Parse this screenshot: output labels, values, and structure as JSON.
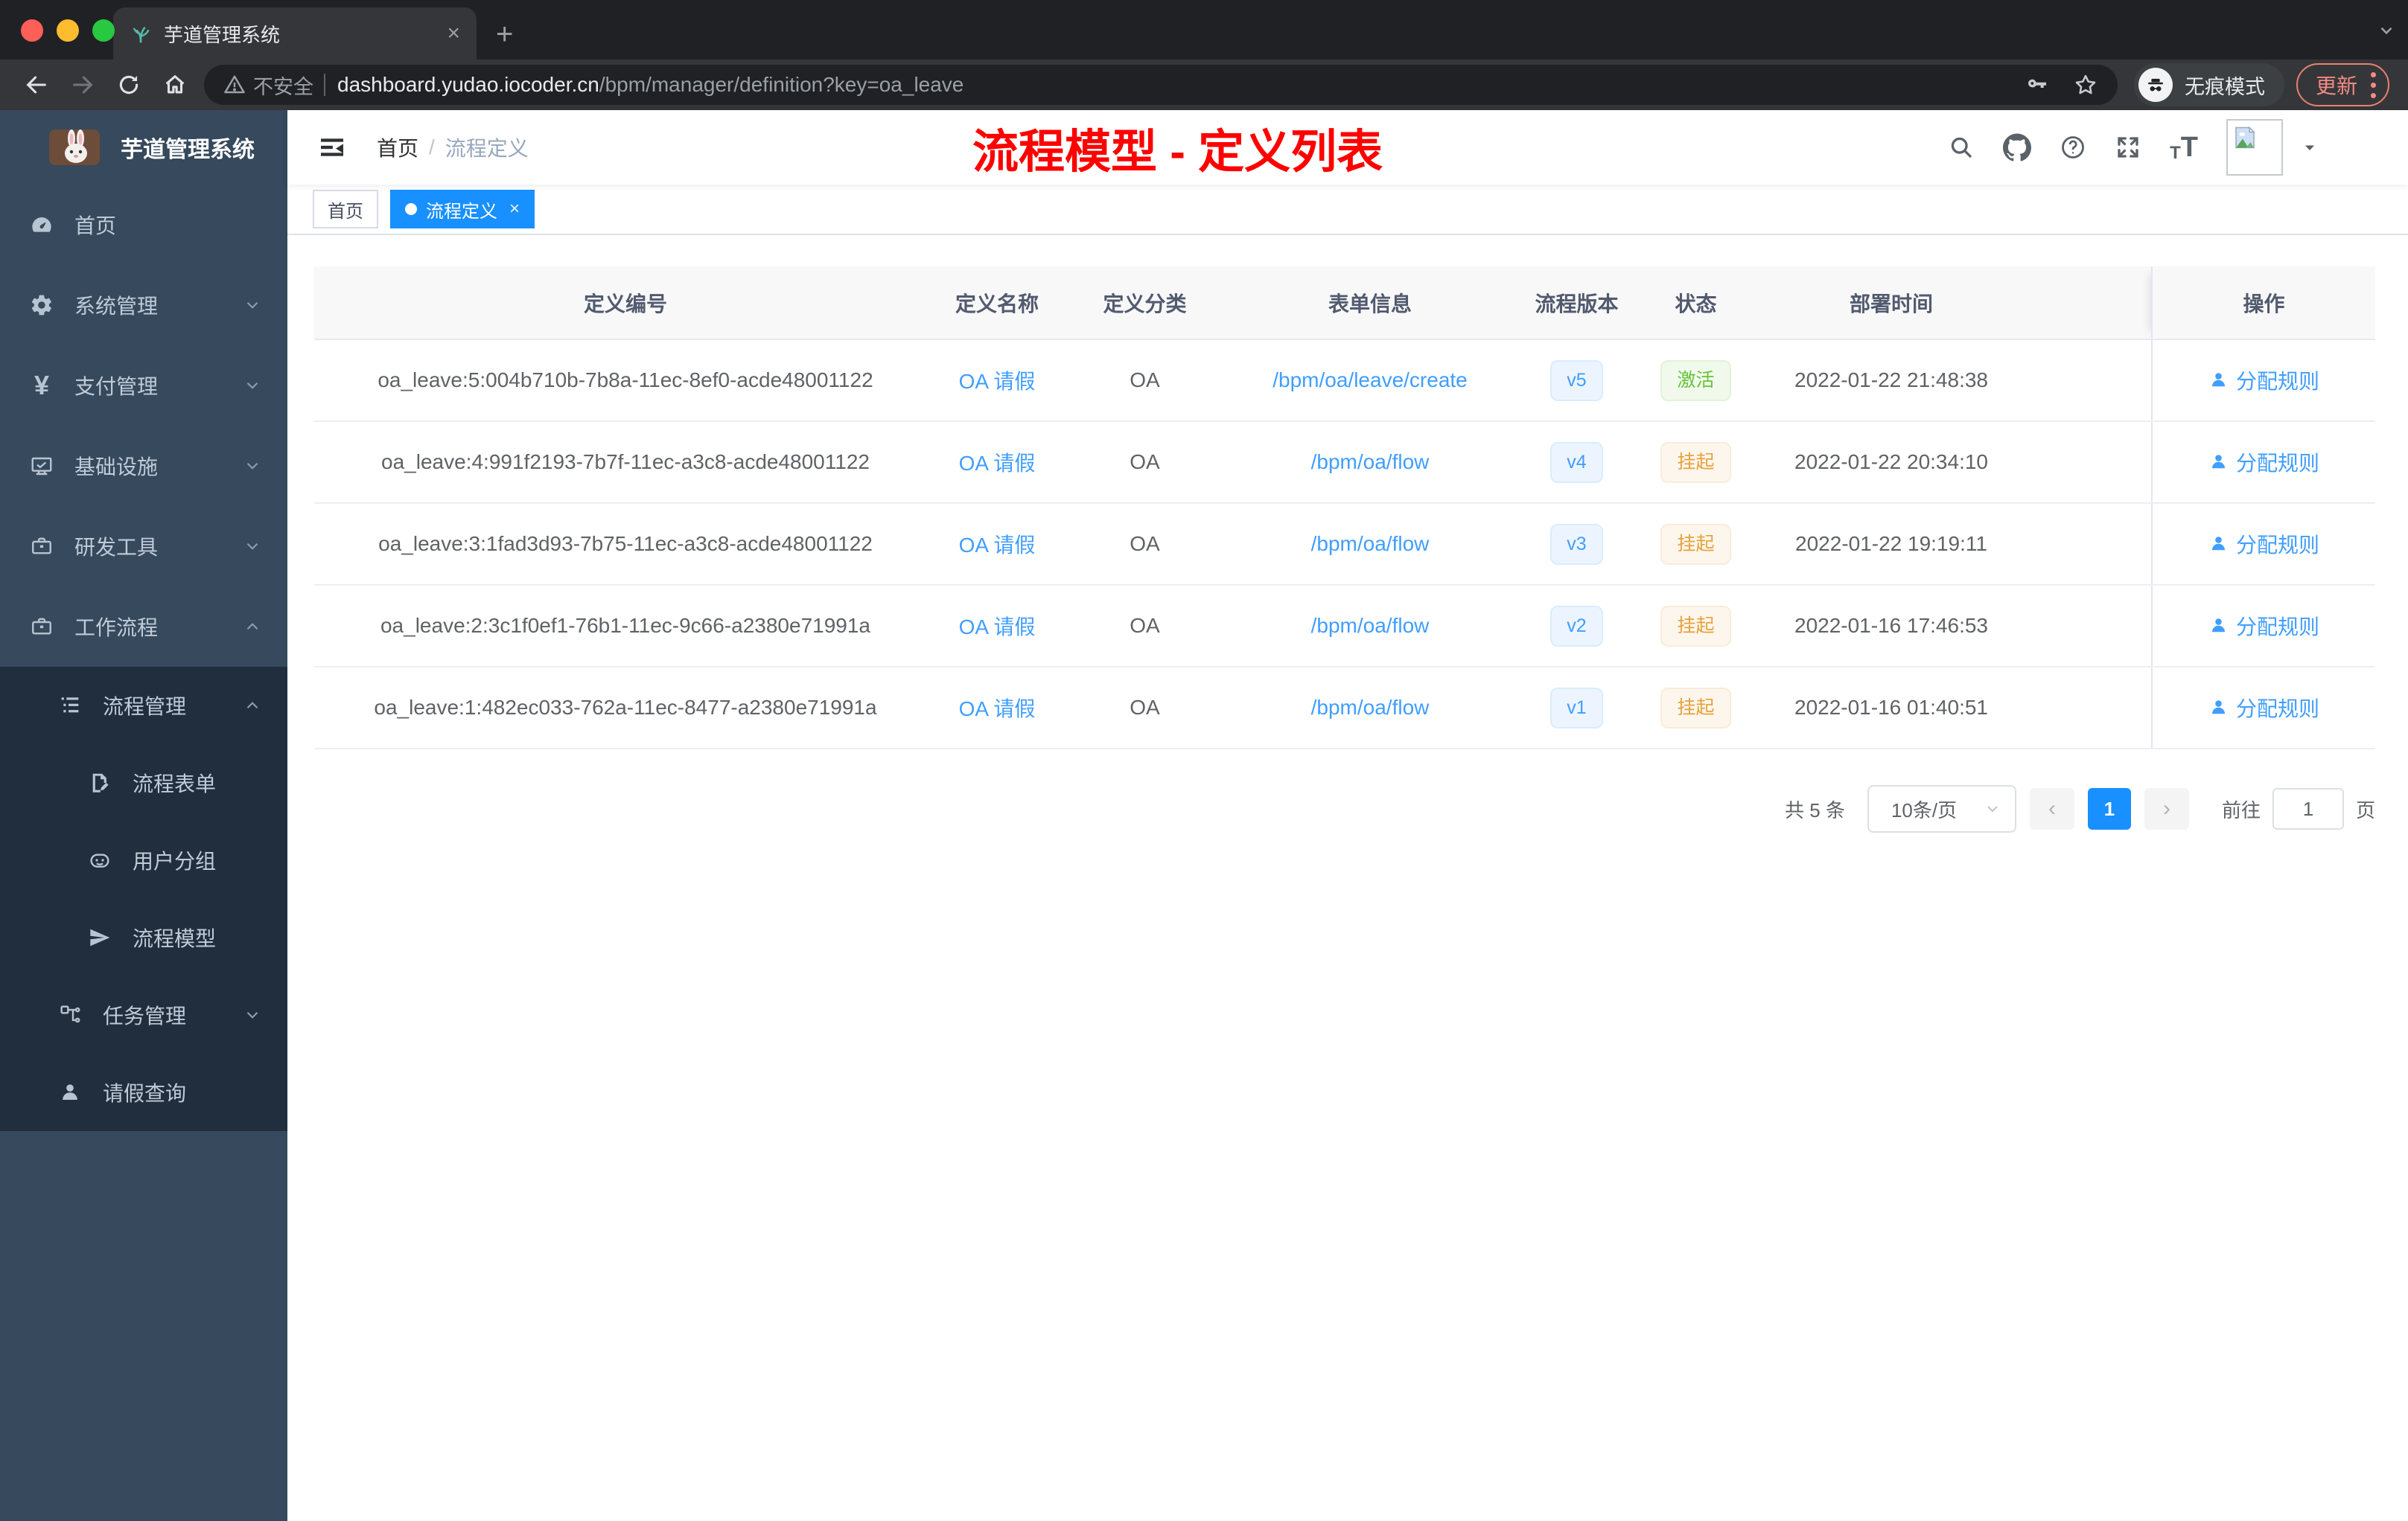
{
  "colors": {
    "accent": "#1890ff",
    "link": "#409eff",
    "success": "#67c23a",
    "warning": "#e6a23c",
    "annotation": "#ff0000"
  },
  "browser": {
    "tab_title": "芋道管理系统",
    "security_label": "不安全",
    "url_host": "dashboard.yudao.iocoder.cn",
    "url_path": "/bpm/manager/definition?key=oa_leave",
    "incognito_label": "无痕模式",
    "update_label": "更新"
  },
  "sidebar": {
    "logo_title": "芋道管理系统",
    "items": [
      {
        "label": "首页"
      },
      {
        "label": "系统管理"
      },
      {
        "label": "支付管理"
      },
      {
        "label": "基础设施"
      },
      {
        "label": "研发工具"
      },
      {
        "label": "工作流程"
      },
      {
        "label": "流程管理"
      },
      {
        "label": "流程表单"
      },
      {
        "label": "用户分组"
      },
      {
        "label": "流程模型"
      },
      {
        "label": "任务管理"
      },
      {
        "label": "请假查询"
      }
    ]
  },
  "navbar": {
    "breadcrumb": {
      "home": "首页",
      "separator": "/",
      "current": "流程定义"
    },
    "annotation": "流程模型 - 定义列表"
  },
  "tags": {
    "home": "首页",
    "active": "流程定义"
  },
  "table": {
    "columns": {
      "id": "定义编号",
      "name": "定义名称",
      "category": "定义分类",
      "form": "表单信息",
      "version": "流程版本",
      "status": "状态",
      "time": "部署时间",
      "action": "操作"
    },
    "rows": [
      {
        "id": "oa_leave:5:004b710b-7b8a-11ec-8ef0-acde48001122",
        "name": "OA 请假",
        "category": "OA",
        "form": "/bpm/oa/leave/create",
        "version": "v5",
        "status": "激活",
        "time": "2022-01-22 21:48:38",
        "action": "分配规则"
      },
      {
        "id": "oa_leave:4:991f2193-7b7f-11ec-a3c8-acde48001122",
        "name": "OA 请假",
        "category": "OA",
        "form": "/bpm/oa/flow",
        "version": "v4",
        "status": "挂起",
        "time": "2022-01-22 20:34:10",
        "action": "分配规则"
      },
      {
        "id": "oa_leave:3:1fad3d93-7b75-11ec-a3c8-acde48001122",
        "name": "OA 请假",
        "category": "OA",
        "form": "/bpm/oa/flow",
        "version": "v3",
        "status": "挂起",
        "time": "2022-01-22 19:19:11",
        "action": "分配规则"
      },
      {
        "id": "oa_leave:2:3c1f0ef1-76b1-11ec-9c66-a2380e71991a",
        "name": "OA 请假",
        "category": "OA",
        "form": "/bpm/oa/flow",
        "version": "v2",
        "status": "挂起",
        "time": "2022-01-16 17:46:53",
        "action": "分配规则"
      },
      {
        "id": "oa_leave:1:482ec033-762a-11ec-8477-a2380e71991a",
        "name": "OA 请假",
        "category": "OA",
        "form": "/bpm/oa/flow",
        "version": "v1",
        "status": "挂起",
        "time": "2022-01-16 01:40:51",
        "action": "分配规则"
      }
    ]
  },
  "pagination": {
    "total": "共 5 条",
    "page_size": "10条/页",
    "page": "1",
    "goto": "前往",
    "goto_value": "1",
    "unit": "页"
  }
}
